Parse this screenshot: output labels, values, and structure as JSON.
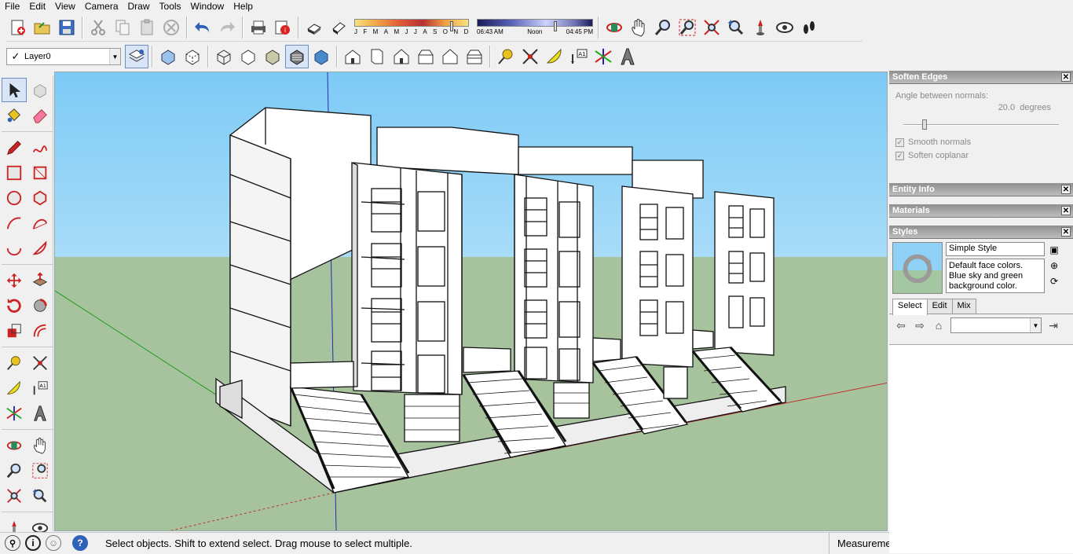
{
  "menubar": {
    "items": [
      "File",
      "Edit",
      "View",
      "Camera",
      "Draw",
      "Tools",
      "Window",
      "Help"
    ]
  },
  "layer": {
    "name": "Layer0",
    "check": "✓"
  },
  "shadow": {
    "months": [
      "J",
      "F",
      "M",
      "A",
      "M",
      "J",
      "J",
      "A",
      "S",
      "O",
      "N",
      "D"
    ],
    "time_start": "06:43 AM",
    "time_noon": "Noon",
    "time_end": "04:45 PM"
  },
  "tray": {
    "soften": {
      "title": "Soften Edges",
      "angle_label": "Angle between normals:",
      "angle_value": "20.0",
      "angle_unit": "degrees",
      "smooth_label": "Smooth normals",
      "coplanar_label": "Soften coplanar"
    },
    "entity": {
      "title": "Entity Info"
    },
    "materials": {
      "title": "Materials"
    },
    "styles": {
      "title": "Styles",
      "name": "Simple Style",
      "description": "Default face colors. Blue sky and green background color.",
      "tabs": [
        "Select",
        "Edit",
        "Mix"
      ],
      "active_tab": "Select"
    }
  },
  "status": {
    "text": "Select objects. Shift to extend select. Drag mouse to select multiple.",
    "measurements_label": "Measurements"
  },
  "colors": {
    "sky": "#86cff6",
    "ground": "#a7c39e",
    "accent": "#6b8ec9"
  }
}
